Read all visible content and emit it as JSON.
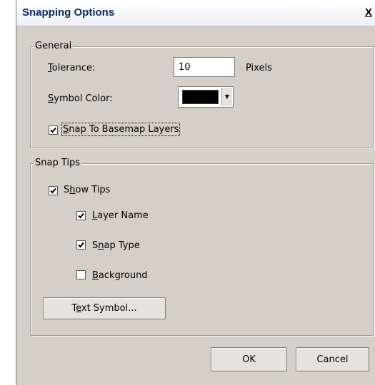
{
  "window": {
    "title": "Snapping Options",
    "close_glyph": "X"
  },
  "general": {
    "legend": "General",
    "tolerance": {
      "label_accel": "T",
      "label_rest": "olerance:",
      "value": "10",
      "unit": "Pixels"
    },
    "symbol_color": {
      "label_accel": "S",
      "label_rest": "ymbol Color:",
      "swatch_color": "#000000"
    },
    "snap_basemap": {
      "accel": "S",
      "rest": "nap To Basemap Layers",
      "checked": true
    }
  },
  "snap_tips": {
    "legend": "Snap Tips",
    "show_tips": {
      "pre": "S",
      "accel": "h",
      "rest": "ow Tips",
      "checked": true
    },
    "layer_name": {
      "accel": "L",
      "rest": "ayer Name",
      "checked": true
    },
    "snap_type": {
      "pre": "S",
      "accel": "n",
      "rest": "ap Type",
      "checked": true
    },
    "background": {
      "accel": "B",
      "rest": "ackground",
      "checked": false
    },
    "text_symbol_button": {
      "pre": "T",
      "accel": "e",
      "rest": "xt Symbol..."
    }
  },
  "footer": {
    "ok_label": "OK",
    "cancel_label": "Cancel"
  },
  "colors": {
    "dialog_bg": "#d4d0c8",
    "title_text": "#0a2a66"
  }
}
